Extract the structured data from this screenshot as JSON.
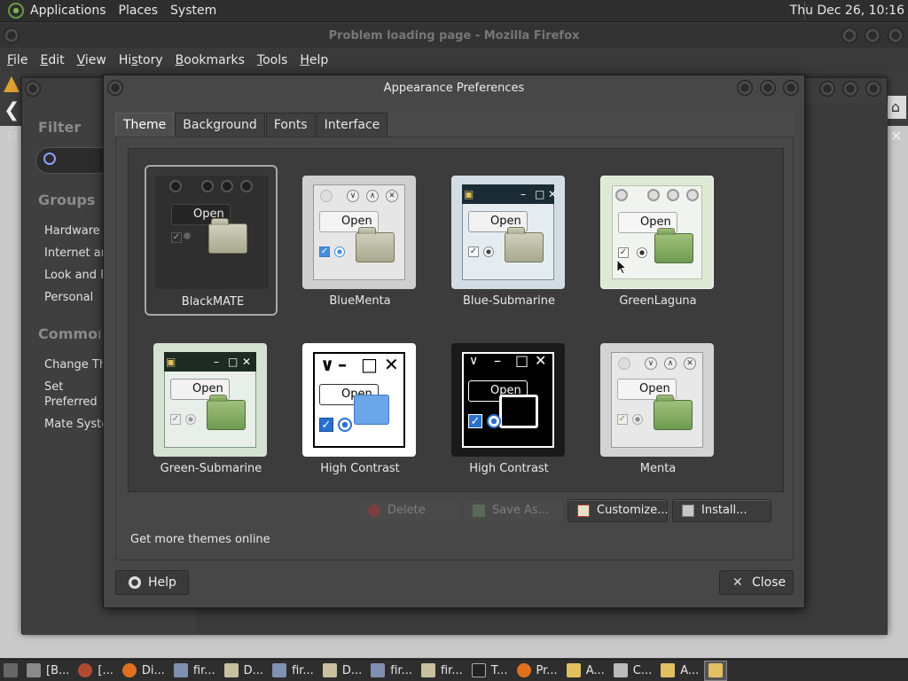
{
  "top_panel": {
    "menus": [
      "Applications",
      "Places",
      "System"
    ],
    "clock": "Thu Dec 26, 10:16"
  },
  "firefox": {
    "title": "Problem loading page - Mozilla Firefox",
    "menu": [
      {
        "u": "F",
        "rest": "ile"
      },
      {
        "u": "E",
        "rest": "dit"
      },
      {
        "u": "V",
        "rest": "iew"
      },
      {
        "pre": "Hi",
        "u": "s",
        "rest": "tory"
      },
      {
        "u": "B",
        "rest": "ookmarks"
      },
      {
        "u": "T",
        "rest": "ools"
      },
      {
        "u": "H",
        "rest": "elp"
      }
    ]
  },
  "control_center": {
    "filter_label": "Filter",
    "groups_label": "Groups",
    "groups": [
      "Hardware",
      "Internet and Network",
      "Look and Feel",
      "Personal"
    ],
    "common_label": "Common Tasks",
    "common": [
      "Change Theme",
      "Set Preferred Applications",
      "Mate System Monitor"
    ]
  },
  "dialog": {
    "title": "Appearance Preferences",
    "tabs": [
      "Theme",
      "Background",
      "Fonts",
      "Interface"
    ],
    "active_tab": "Theme",
    "themes": [
      {
        "name": "BlackMATE",
        "selected": true
      },
      {
        "name": "BlueMenta",
        "selected": false
      },
      {
        "name": "Blue-Submarine",
        "selected": false
      },
      {
        "name": "GreenLaguna",
        "selected": false
      },
      {
        "name": "Green-Submarine",
        "selected": false
      },
      {
        "name": "High Contrast",
        "selected": false
      },
      {
        "name": "High Contrast",
        "selected": false
      },
      {
        "name": "Menta",
        "selected": false
      }
    ],
    "preview_open_label": "Open",
    "buttons": {
      "delete": "Delete",
      "save_as": "Save As...",
      "customize": "Customize...",
      "install": "Install..."
    },
    "get_more": "Get more themes online",
    "help": "Help",
    "close": "Close"
  },
  "taskbar": {
    "items": [
      "[B...",
      "[...",
      "Di...",
      "fir...",
      "D...",
      "fir...",
      "D...",
      "fir...",
      "fir...",
      "T...",
      "Pr...",
      "A...",
      "C...",
      "A...",
      ""
    ]
  }
}
